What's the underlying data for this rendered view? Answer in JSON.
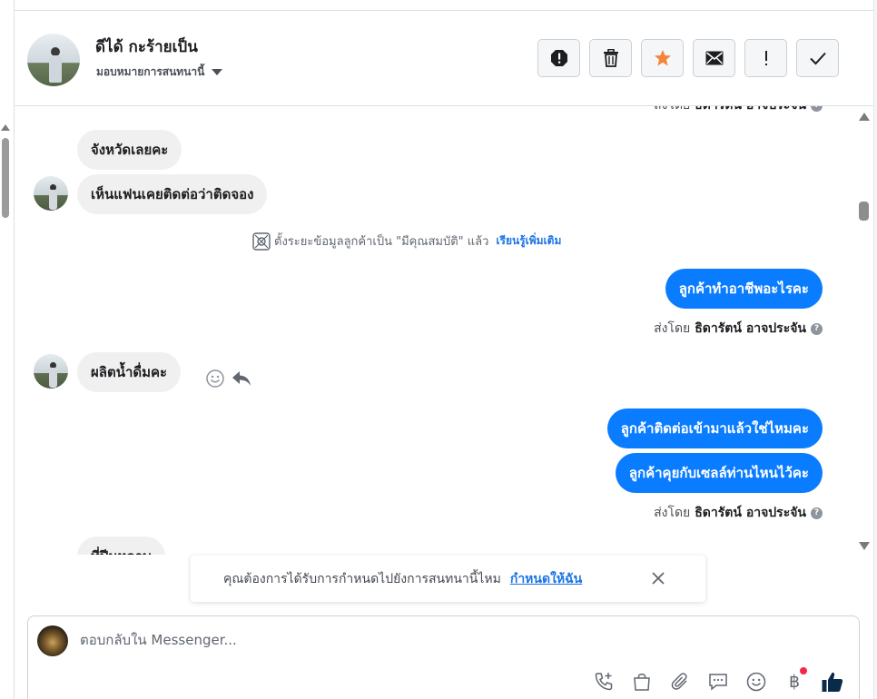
{
  "header": {
    "contact_name": "ดีได้ กะร้ายเป็น",
    "assign_label": "มอบหมายการสนทนานี้",
    "tools": [
      "spam-alert",
      "delete",
      "star",
      "mark-unread",
      "follow-up",
      "done"
    ]
  },
  "messages": [
    {
      "id": "m1",
      "direction": "in",
      "text": "จังหวัดเลยคะ"
    },
    {
      "id": "m2",
      "direction": "in",
      "text": "เห็นแฟนเคยติดต่อว่าติดจอง"
    },
    {
      "id": "m3",
      "direction": "out",
      "text": "ลูกค้าทำอาชีพอะไรคะ"
    },
    {
      "id": "m4",
      "direction": "in",
      "text": "ผลิตน้ำดื่มคะ"
    },
    {
      "id": "m5",
      "direction": "out",
      "text": "ลูกค้าติดต่อเข้ามาแล้วใช่ไหมคะ"
    },
    {
      "id": "m6",
      "direction": "out",
      "text": "ลูกค้าคุยกับเซลล์ท่านไหนไว้คะ"
    },
    {
      "id": "m7",
      "direction": "in",
      "text": "ที่ปีนหลาบ"
    }
  ],
  "system_note": {
    "text": "ตั้งระยะข้อมูลลูกค้าเป็น \"มีคุณสมบัติ\" แล้ว",
    "link": "เรียนรู้เพิ่มเติม"
  },
  "sent_by": {
    "prefix": "ส่งโดย",
    "name": "ธิดารัตน์ อาจประจัน"
  },
  "toast": {
    "text": "คุณต้องการได้รับการกำหนดไปยังการสนทนานี้ไหม",
    "link": "กำหนดให้ฉัน"
  },
  "composer": {
    "placeholder": "ตอบกลับใน Messenger...",
    "tools": [
      "phone-add-icon",
      "shopping-bag-icon",
      "paperclip-icon",
      "chat-bubble-icon",
      "emoji-icon",
      "baht-icon",
      "thumbs-up-icon"
    ],
    "baht_symbol": "฿"
  },
  "colors": {
    "outgoing_bubble": "#0a7cff",
    "incoming_bubble": "#f0f0f0",
    "star": "#f5853a",
    "link": "#1b74e4",
    "thumb": "#0a2a4a"
  }
}
